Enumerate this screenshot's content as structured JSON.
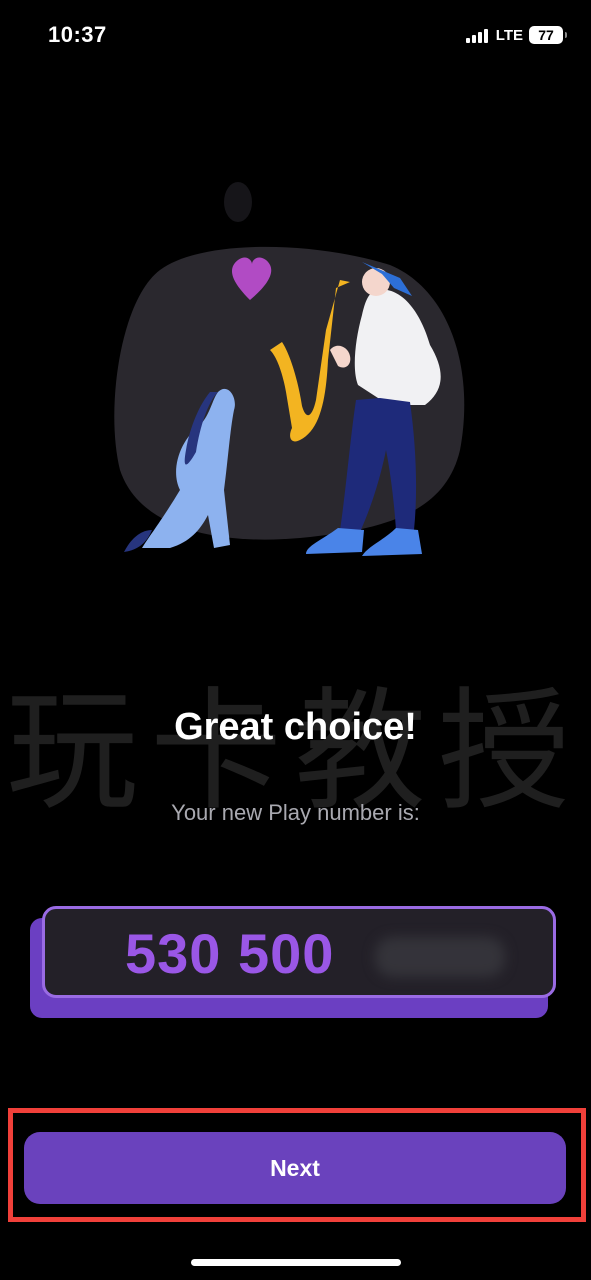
{
  "status_bar": {
    "time": "10:37",
    "network": "LTE",
    "battery": "77"
  },
  "watermark": "玩卡教授",
  "illustration": {
    "subject": "saxophone-player-with-dog"
  },
  "content": {
    "title": "Great choice!",
    "subtitle": "Your new Play number is:",
    "play_number": "530 500"
  },
  "actions": {
    "next_label": "Next"
  },
  "colors": {
    "background": "#000000",
    "accent": "#6a42bd",
    "number_text": "#9a57e6",
    "highlight": "#f0403a"
  }
}
